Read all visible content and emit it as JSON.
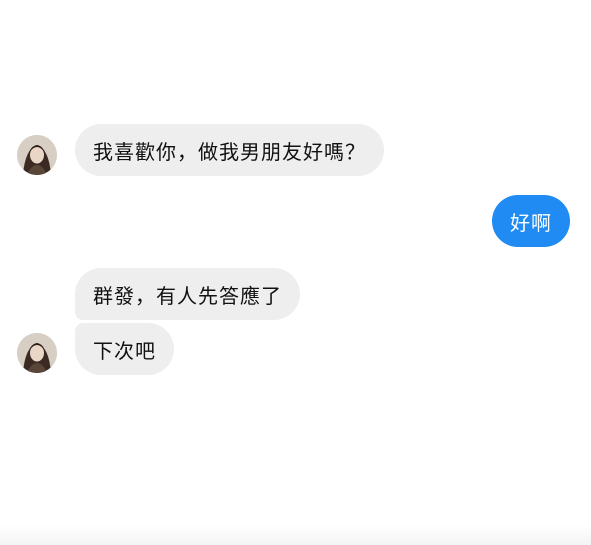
{
  "conversation": {
    "messages": [
      {
        "sender": "contact",
        "text": "我喜歡你，做我男朋友好嗎？"
      },
      {
        "sender": "me",
        "text": "好啊"
      },
      {
        "sender": "contact",
        "text": "群發，有人先答應了"
      },
      {
        "sender": "contact",
        "text": "下次吧"
      }
    ]
  },
  "colors": {
    "incoming_bubble": "#eeeeee",
    "outgoing_bubble": "#1f8bf3",
    "background": "#ffffff"
  },
  "icons": {
    "avatar": "contact-avatar-photo"
  }
}
